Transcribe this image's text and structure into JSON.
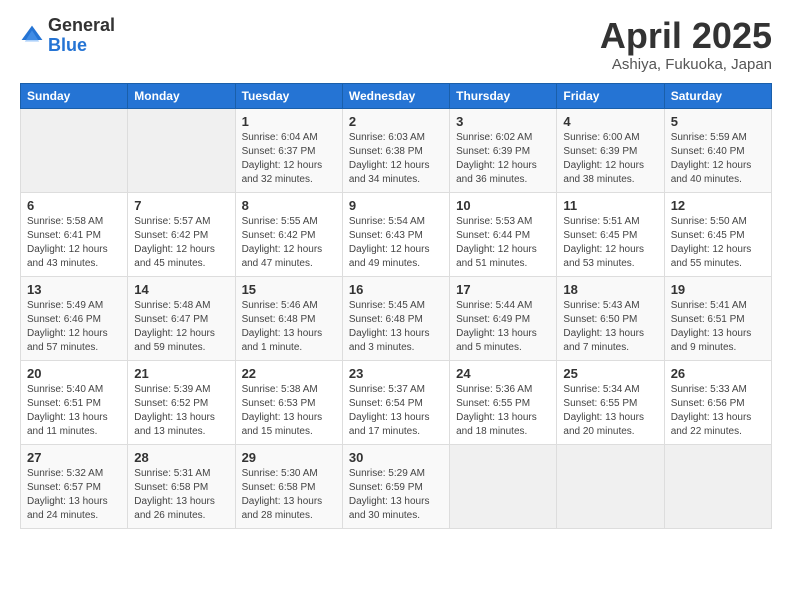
{
  "logo": {
    "general": "General",
    "blue": "Blue"
  },
  "title": "April 2025",
  "location": "Ashiya, Fukuoka, Japan",
  "days_of_week": [
    "Sunday",
    "Monday",
    "Tuesday",
    "Wednesday",
    "Thursday",
    "Friday",
    "Saturday"
  ],
  "weeks": [
    [
      {
        "day": "",
        "info": ""
      },
      {
        "day": "",
        "info": ""
      },
      {
        "day": "1",
        "info": "Sunrise: 6:04 AM\nSunset: 6:37 PM\nDaylight: 12 hours\nand 32 minutes."
      },
      {
        "day": "2",
        "info": "Sunrise: 6:03 AM\nSunset: 6:38 PM\nDaylight: 12 hours\nand 34 minutes."
      },
      {
        "day": "3",
        "info": "Sunrise: 6:02 AM\nSunset: 6:39 PM\nDaylight: 12 hours\nand 36 minutes."
      },
      {
        "day": "4",
        "info": "Sunrise: 6:00 AM\nSunset: 6:39 PM\nDaylight: 12 hours\nand 38 minutes."
      },
      {
        "day": "5",
        "info": "Sunrise: 5:59 AM\nSunset: 6:40 PM\nDaylight: 12 hours\nand 40 minutes."
      }
    ],
    [
      {
        "day": "6",
        "info": "Sunrise: 5:58 AM\nSunset: 6:41 PM\nDaylight: 12 hours\nand 43 minutes."
      },
      {
        "day": "7",
        "info": "Sunrise: 5:57 AM\nSunset: 6:42 PM\nDaylight: 12 hours\nand 45 minutes."
      },
      {
        "day": "8",
        "info": "Sunrise: 5:55 AM\nSunset: 6:42 PM\nDaylight: 12 hours\nand 47 minutes."
      },
      {
        "day": "9",
        "info": "Sunrise: 5:54 AM\nSunset: 6:43 PM\nDaylight: 12 hours\nand 49 minutes."
      },
      {
        "day": "10",
        "info": "Sunrise: 5:53 AM\nSunset: 6:44 PM\nDaylight: 12 hours\nand 51 minutes."
      },
      {
        "day": "11",
        "info": "Sunrise: 5:51 AM\nSunset: 6:45 PM\nDaylight: 12 hours\nand 53 minutes."
      },
      {
        "day": "12",
        "info": "Sunrise: 5:50 AM\nSunset: 6:45 PM\nDaylight: 12 hours\nand 55 minutes."
      }
    ],
    [
      {
        "day": "13",
        "info": "Sunrise: 5:49 AM\nSunset: 6:46 PM\nDaylight: 12 hours\nand 57 minutes."
      },
      {
        "day": "14",
        "info": "Sunrise: 5:48 AM\nSunset: 6:47 PM\nDaylight: 12 hours\nand 59 minutes."
      },
      {
        "day": "15",
        "info": "Sunrise: 5:46 AM\nSunset: 6:48 PM\nDaylight: 13 hours\nand 1 minute."
      },
      {
        "day": "16",
        "info": "Sunrise: 5:45 AM\nSunset: 6:48 PM\nDaylight: 13 hours\nand 3 minutes."
      },
      {
        "day": "17",
        "info": "Sunrise: 5:44 AM\nSunset: 6:49 PM\nDaylight: 13 hours\nand 5 minutes."
      },
      {
        "day": "18",
        "info": "Sunrise: 5:43 AM\nSunset: 6:50 PM\nDaylight: 13 hours\nand 7 minutes."
      },
      {
        "day": "19",
        "info": "Sunrise: 5:41 AM\nSunset: 6:51 PM\nDaylight: 13 hours\nand 9 minutes."
      }
    ],
    [
      {
        "day": "20",
        "info": "Sunrise: 5:40 AM\nSunset: 6:51 PM\nDaylight: 13 hours\nand 11 minutes."
      },
      {
        "day": "21",
        "info": "Sunrise: 5:39 AM\nSunset: 6:52 PM\nDaylight: 13 hours\nand 13 minutes."
      },
      {
        "day": "22",
        "info": "Sunrise: 5:38 AM\nSunset: 6:53 PM\nDaylight: 13 hours\nand 15 minutes."
      },
      {
        "day": "23",
        "info": "Sunrise: 5:37 AM\nSunset: 6:54 PM\nDaylight: 13 hours\nand 17 minutes."
      },
      {
        "day": "24",
        "info": "Sunrise: 5:36 AM\nSunset: 6:55 PM\nDaylight: 13 hours\nand 18 minutes."
      },
      {
        "day": "25",
        "info": "Sunrise: 5:34 AM\nSunset: 6:55 PM\nDaylight: 13 hours\nand 20 minutes."
      },
      {
        "day": "26",
        "info": "Sunrise: 5:33 AM\nSunset: 6:56 PM\nDaylight: 13 hours\nand 22 minutes."
      }
    ],
    [
      {
        "day": "27",
        "info": "Sunrise: 5:32 AM\nSunset: 6:57 PM\nDaylight: 13 hours\nand 24 minutes."
      },
      {
        "day": "28",
        "info": "Sunrise: 5:31 AM\nSunset: 6:58 PM\nDaylight: 13 hours\nand 26 minutes."
      },
      {
        "day": "29",
        "info": "Sunrise: 5:30 AM\nSunset: 6:58 PM\nDaylight: 13 hours\nand 28 minutes."
      },
      {
        "day": "30",
        "info": "Sunrise: 5:29 AM\nSunset: 6:59 PM\nDaylight: 13 hours\nand 30 minutes."
      },
      {
        "day": "",
        "info": ""
      },
      {
        "day": "",
        "info": ""
      },
      {
        "day": "",
        "info": ""
      }
    ]
  ]
}
